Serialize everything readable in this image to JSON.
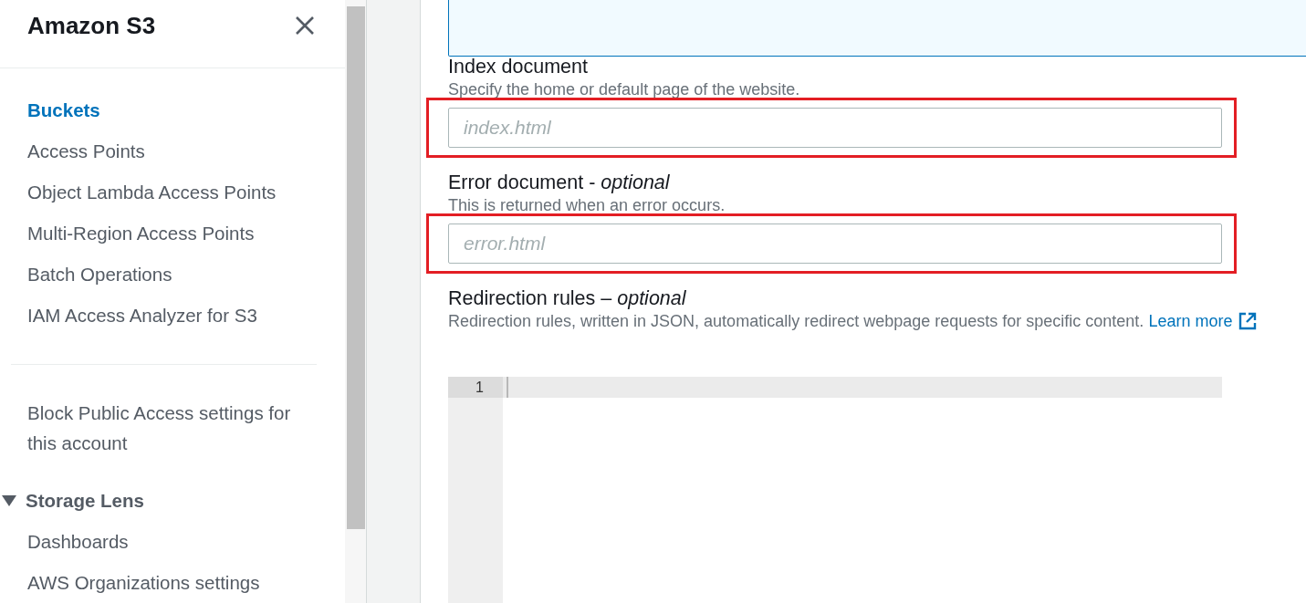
{
  "sidebar": {
    "title": "Amazon S3",
    "items": [
      {
        "label": "Buckets",
        "selected": true
      },
      {
        "label": "Access Points",
        "selected": false
      },
      {
        "label": "Object Lambda Access Points",
        "selected": false
      },
      {
        "label": "Multi-Region Access Points",
        "selected": false
      },
      {
        "label": "Batch Operations",
        "selected": false
      },
      {
        "label": "IAM Access Analyzer for S3",
        "selected": false
      }
    ],
    "secondary_items": [
      {
        "label": "Block Public Access settings for this account",
        "selected": false
      }
    ],
    "groups": [
      {
        "label": "Storage Lens",
        "expanded": true,
        "children": [
          {
            "label": "Dashboards",
            "selected": false
          },
          {
            "label": "AWS Organizations settings",
            "selected": false
          }
        ]
      }
    ]
  },
  "form": {
    "fields": [
      {
        "kind": "input",
        "label": "Index document",
        "description": "Specify the home or default page of the website.",
        "placeholder": "index.html",
        "highlighted": true
      },
      {
        "kind": "input",
        "label": "Error document - *optional*",
        "description": "This is returned when an error occurs.",
        "placeholder": "error.html",
        "highlighted": true
      },
      {
        "kind": "code_editor",
        "label": "Redirection rules – *optional*",
        "description": "Redirection rules, written in JSON, automatically redirect webpage requests for specific content.",
        "link": "Learn more",
        "highlighted": false,
        "lines": [
          {
            "number": "1",
            "active": true
          }
        ]
      }
    ]
  }
}
